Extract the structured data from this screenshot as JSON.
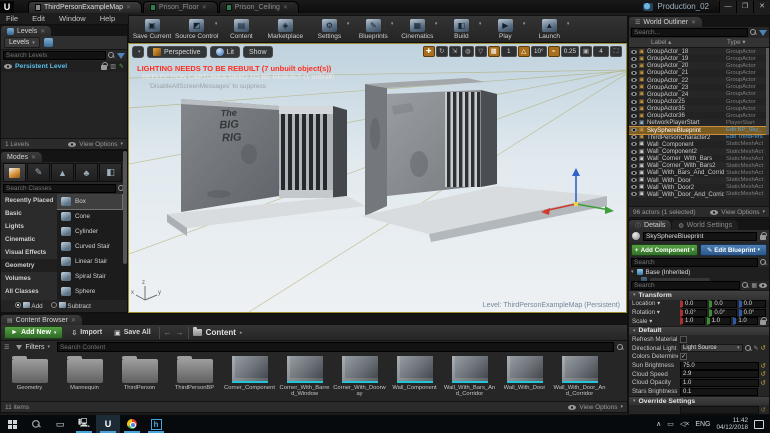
{
  "colors": {
    "accent_orange": "#cf8a1f",
    "accent_green": "#4f9e42",
    "accent_blue": "#3e76b0",
    "link_blue": "#4fa3e0",
    "asset_teal": "#25c3d8",
    "selection_orange": "#7d5c22",
    "warning_red": "#ff2d20",
    "viewport_border": "#9a8a2e"
  },
  "titlebar": {
    "tabs": [
      {
        "label": "ThirdPersonExampleMap",
        "_class": "active"
      },
      {
        "label": "Prison_Floor"
      },
      {
        "label": "Prison_Ceiling"
      }
    ],
    "session": "Production_02",
    "minimize": "—",
    "maximize": "❐",
    "close": "✕"
  },
  "menubar": {
    "items": [
      {
        "label": "File"
      },
      {
        "label": "Edit"
      },
      {
        "label": "Window"
      },
      {
        "label": "Help"
      }
    ]
  },
  "toolbar": {
    "buttons": [
      {
        "label": "Save Current",
        "icon": "save-icon",
        "glyph": "▣",
        "caret": ""
      },
      {
        "label": "Source Control",
        "icon": "source-control-icon",
        "glyph": "◩",
        "caret": "▾"
      },
      {
        "label": "Content",
        "icon": "content-icon",
        "glyph": "▤",
        "caret": ""
      },
      {
        "label": "Marketplace",
        "icon": "marketplace-icon",
        "glyph": "◈",
        "caret": ""
      },
      {
        "label": "Settings",
        "icon": "settings-icon",
        "glyph": "⚙",
        "caret": "▾"
      },
      {
        "label": "Blueprints",
        "icon": "blueprints-icon",
        "glyph": "✎",
        "caret": "▾"
      },
      {
        "label": "Cinematics",
        "icon": "cinematics-icon",
        "glyph": "▦",
        "caret": "▾"
      },
      {
        "label": "Build",
        "icon": "build-icon",
        "glyph": "◧",
        "caret": "▾"
      },
      {
        "label": "Play",
        "icon": "play-icon",
        "glyph": "▶",
        "caret": "▾"
      },
      {
        "label": "Launch",
        "icon": "launch-icon",
        "glyph": "▲",
        "caret": "▾"
      }
    ]
  },
  "levels": {
    "tab": "Levels",
    "menu_button": "Levels",
    "search_placeholder": "Search Levels",
    "persistent": "Persistent Level",
    "footer_count": "1 Levels",
    "view_options": "View Options"
  },
  "modes": {
    "tab": "Modes",
    "search_placeholder": "Search Classes",
    "categories": [
      {
        "label": "Recently Placed"
      },
      {
        "label": "Basic"
      },
      {
        "label": "Lights"
      },
      {
        "label": "Cinematic"
      },
      {
        "label": "Visual Effects"
      },
      {
        "label": "Geometry",
        "_class": "active"
      },
      {
        "label": "Volumes"
      },
      {
        "label": "All Classes"
      }
    ],
    "items": [
      {
        "label": "Box",
        "_class": "selected"
      },
      {
        "label": "Cone"
      },
      {
        "label": "Cylinder"
      },
      {
        "label": "Curved Stair"
      },
      {
        "label": "Linear Stair"
      },
      {
        "label": "Spiral Stair"
      },
      {
        "label": "Sphere"
      }
    ],
    "add_label": "Add",
    "subtract_label": "Subtract"
  },
  "viewport": {
    "perspective": "Perspective",
    "lit": "Lit",
    "show": "Show",
    "warning1": "LIGHTING NEEDS TO BE REBUILT (7 unbuilt object(s))",
    "warning2": "REFLECTION CAPTURES NEED TO BE REBUILT (1 unbuilt)",
    "warning3": "'DisableAllScreenMessages' to suppress",
    "level_label": "Level: ThirdPersonExampleMap (Persistent)",
    "graffiti_lines": [
      "The",
      "BIG",
      "RIG"
    ],
    "snap_grid": "1",
    "snap_angle": "10°",
    "snap_scale": "0.25",
    "camera_speed": "4"
  },
  "outliner": {
    "tab": "World Outliner",
    "search_placeholder": "Search...",
    "col_label": "Label",
    "col_type": "Type",
    "rows": [
      {
        "label": "GroupActor_18",
        "type": "GroupActor",
        "_class": "grp"
      },
      {
        "label": "GroupActor_19",
        "type": "GroupActor",
        "_class": "grp"
      },
      {
        "label": "GroupActor_20",
        "type": "GroupActor",
        "_class": "grp"
      },
      {
        "label": "GroupActor_21",
        "type": "GroupActor",
        "_class": "grp"
      },
      {
        "label": "GroupActor_22",
        "type": "GroupActor",
        "_class": "grp"
      },
      {
        "label": "GroupActor_23",
        "type": "GroupActor",
        "_class": "grp"
      },
      {
        "label": "GroupActor_24",
        "type": "GroupActor",
        "_class": "grp"
      },
      {
        "label": "GroupActor25",
        "type": "GroupActor",
        "_class": "grp"
      },
      {
        "label": "GroupActor35",
        "type": "GroupActor",
        "_class": "grp"
      },
      {
        "label": "GroupActor36",
        "type": "GroupActor",
        "_class": "grp"
      },
      {
        "label": "NetworkPlayerStart",
        "type": "PlayerStart",
        "_class": "ps"
      },
      {
        "label": "SkySphereBlueprint",
        "type": "Edit BP_Sky_",
        "_class": "selected link"
      },
      {
        "label": "ThirdPersonCharacter2",
        "type": "Edit ThirdPers",
        "_class": "link"
      },
      {
        "label": "Wall_Component",
        "type": "StaticMeshAct",
        "_class": "mesh"
      },
      {
        "label": "Wall_Component2",
        "type": "StaticMeshAct",
        "_class": "mesh"
      },
      {
        "label": "Wall_Corner_With_Bars",
        "type": "StaticMeshAct",
        "_class": "mesh"
      },
      {
        "label": "Wall_Corner_With_Bars2",
        "type": "StaticMeshAct",
        "_class": "mesh"
      },
      {
        "label": "Wall_With_Bars_And_Corrid",
        "type": "StaticMeshAct",
        "_class": "mesh"
      },
      {
        "label": "Wall_With_Door",
        "type": "StaticMeshAct",
        "_class": "mesh"
      },
      {
        "label": "Wall_With_Door2",
        "type": "StaticMeshAct",
        "_class": "mesh"
      },
      {
        "label": "Wall_With_Door_And_Corrid",
        "type": "StaticMeshAct",
        "_class": "mesh"
      }
    ],
    "footer": "96 actors (1 selected)",
    "view_options": "View Options"
  },
  "details": {
    "tab_details": "Details",
    "tab_world": "World Settings",
    "name": "SkySphereBlueprint",
    "add_component": "Add Component",
    "edit_blueprint": "Edit Blueprint",
    "search_placeholder": "Search",
    "component_root": "Base (Inherited)",
    "sections": {
      "transform": "Transform",
      "default": "Default",
      "override": "Override Settings"
    },
    "transform": {
      "location_label": "Location",
      "rotation_label": "Rotation",
      "scale_label": "Scale",
      "location": [
        "0.0",
        "0.0",
        "0.0"
      ],
      "rotation": [
        "0.0°",
        "0.0°",
        "0.0°"
      ],
      "scale": [
        "1.0",
        "1.0",
        "1.0"
      ]
    },
    "defaults": [
      {
        "label": "Refresh Material"
      },
      {
        "label": "Directional Light A",
        "value": "Light Source"
      },
      {
        "label": "Colors Determined"
      },
      {
        "label": "Sun Brightness",
        "value": "75.0"
      },
      {
        "label": "Cloud Speed",
        "value": "2.9"
      },
      {
        "label": "Cloud Opacity",
        "value": "1.0"
      },
      {
        "label": "Stars Brightness",
        "value": "0.1"
      }
    ]
  },
  "content": {
    "tab": "Content Browser",
    "add_new": "Add New",
    "import": "Import",
    "save_all": "Save All",
    "breadcrumb": "Content",
    "filters": "Filters",
    "search_placeholder": "Search Content",
    "items": [
      {
        "label": "Geometry",
        "_class": "folder"
      },
      {
        "label": "Mannequin",
        "_class": "folder"
      },
      {
        "label": "ThirdPerson",
        "_class": "folder"
      },
      {
        "label": "ThirdPersonBP",
        "_class": "folder"
      },
      {
        "label": "Corner_Component",
        "_class": "asset"
      },
      {
        "label": "Corner_With_Barred_Window",
        "_class": "asset"
      },
      {
        "label": "Corner_With_Doorway",
        "_class": "asset"
      },
      {
        "label": "Wall_Component",
        "_class": "asset"
      },
      {
        "label": "Wall_With_Bars_And_Corridor",
        "_class": "asset"
      },
      {
        "label": "Wall_With_Door",
        "_class": "asset"
      },
      {
        "label": "Wall_With_Door_And_Corridor",
        "_class": "asset"
      }
    ],
    "footer": "11 items",
    "view_options": "View Options"
  },
  "taskbar": {
    "language": "ENG",
    "time": "11:42",
    "date": "04/12/2018"
  }
}
